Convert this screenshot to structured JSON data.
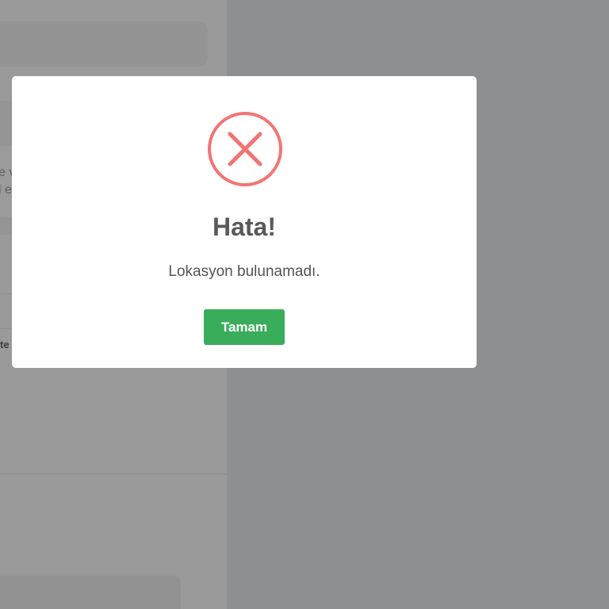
{
  "background": {
    "fragment_line1": "e v",
    "fragment_line2": "l e",
    "fragment_row": "te"
  },
  "dialog": {
    "icon": "error-x-icon",
    "icon_color": "#f27474",
    "title": "Hata!",
    "message": "Lokasyon bulunamadı.",
    "confirm_label": "Tamam",
    "confirm_color": "#3aad5b"
  }
}
